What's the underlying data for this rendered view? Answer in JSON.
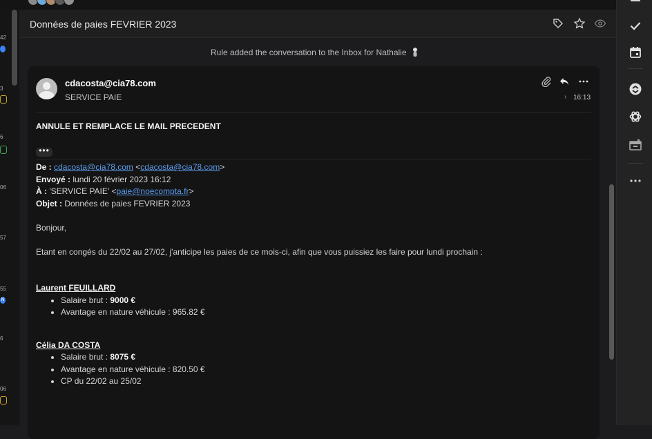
{
  "header": {
    "title": "Données de paies FEVRIER 2023"
  },
  "notice": {
    "text": "Rule added the conversation to the Inbox for Nathalie"
  },
  "left_list": {
    "numbers": [
      "42",
      "3",
      "6",
      "06",
      "57",
      "55",
      "6",
      "06"
    ],
    "badge": "N"
  },
  "message": {
    "from_address": "cdacosta@cia78.com",
    "to_name": "SERVICE PAIE",
    "time": "16:13",
    "subject_line": "ANNULE ET REMPLACE LE MAIL PRECEDENT",
    "more_dots": "•••",
    "fwd": {
      "de_label": "De :",
      "de_value": "cdacosta@cia78.com",
      "de_lt": "<",
      "de_gt": ">",
      "envoye_label": "Envoyé :",
      "envoye_value": "lundi 20 février 2023 16:12",
      "a_label": "À :",
      "a_name": "'SERVICE PAIE' <",
      "a_value": "paie@noecompta.fr",
      "a_gt": ">",
      "objet_label": "Objet :",
      "objet_value": "Données de paies FEVRIER 2023"
    },
    "greeting": "Bonjour,",
    "intro": "Etant en congés du 22/02 au 27/02, j'anticipe les paies de ce mois-ci, afin que vous puissiez les faire pour lundi prochain :",
    "employees": [
      {
        "name": "Laurent FEUILLARD",
        "salary_label": "Salaire brut : ",
        "salary_value": "9000 €",
        "vehicle": "Avantage en nature véhicule : 965.82 €"
      },
      {
        "name": "Célia DA COSTA",
        "salary_label": "Salaire brut : ",
        "salary_value": "8075 €",
        "vehicle": "Avantage en nature véhicule : 820.50 €",
        "cp": "CP du 22/02 au 25/02"
      }
    ]
  },
  "colors": {
    "background": "#1c1c1e",
    "card": "#141414",
    "link": "#5c9cf0",
    "text": "#d4d4d4"
  },
  "icons": [
    "tag-icon",
    "star-icon",
    "eye-icon",
    "attachment-icon",
    "reply-icon",
    "more-icon",
    "check-icon",
    "calendar-icon",
    "sync-icon",
    "openai-icon",
    "archive-icon",
    "more-horizontal-icon"
  ]
}
